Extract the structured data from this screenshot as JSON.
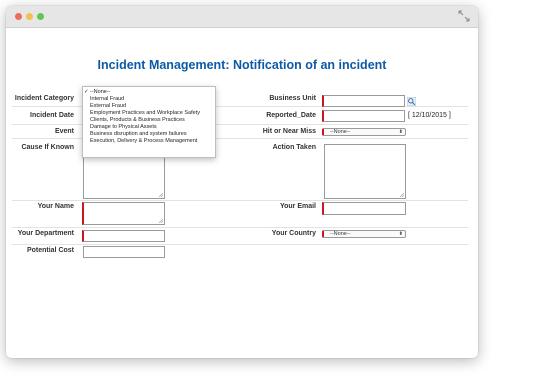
{
  "window": {
    "controls": [
      "close",
      "minimize",
      "maximize"
    ],
    "expand_icon": "expand-arrows-icon"
  },
  "page": {
    "title": "Incident Management: Notification of an incident"
  },
  "form": {
    "left": {
      "incident_category_label": "Incident Category",
      "incident_date_label": "Incident Date",
      "event_label": "Event",
      "cause_label": "Cause If Known",
      "your_name_label": "Your Name",
      "your_department_label": "Your Department",
      "potential_cost_label": "Potential Cost"
    },
    "right": {
      "business_unit_label": "Business Unit",
      "reported_date_label": "Reported_Date",
      "reported_date_value": "[ 12/10/2015 ]",
      "hit_or_near_miss_label": "Hit or Near Miss",
      "hit_or_near_miss_value": "--None--",
      "action_taken_label": "Action Taken",
      "your_email_label": "Your Email",
      "your_country_label": "Your Country",
      "your_country_value": "--None--"
    },
    "required_color": "#c8161d",
    "title_color": "#0d5aa6"
  },
  "incident_category_dropdown": {
    "selected": "--None--",
    "options": [
      "--None--",
      "Internal Fraud",
      "External Fraud",
      "Employment Practices and Workplace Safety",
      "Clients, Products & Business Practices",
      "Damage to Physical Assets",
      "Business disruption and system failures",
      "Execution, Delivery & Process Management"
    ]
  }
}
